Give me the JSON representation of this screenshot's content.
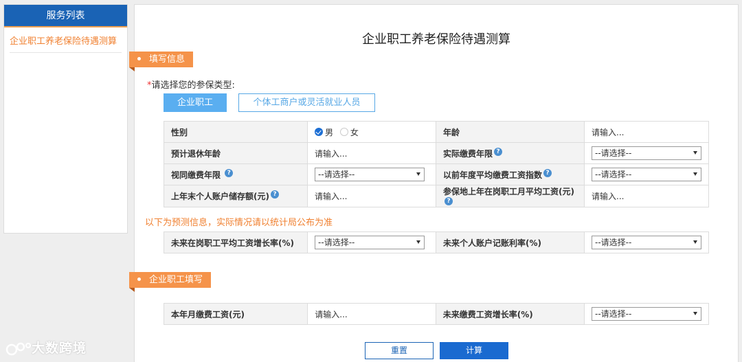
{
  "sidebar": {
    "header": "服务列表",
    "items": [
      {
        "label": "企业职工养老保险待遇测算"
      }
    ]
  },
  "main": {
    "title": "企业职工养老保险待遇测算",
    "section1": "填写信息",
    "type_label": "请选择您的参保类型:",
    "type_required_mark": "*",
    "type_options": [
      "企业职工",
      "个体工商户或灵活就业人员"
    ],
    "selected_type": "企业职工",
    "rows": {
      "gender_label": "性别",
      "gender_options": [
        "男",
        "女"
      ],
      "gender_selected": "男",
      "age_label": "年龄",
      "age_placeholder": "请输入...",
      "retire_age_label": "预计退休年龄",
      "retire_age_placeholder": "请输入...",
      "actual_years_label": "实际缴费年限",
      "actual_years_value": "--请选择--",
      "deemed_years_label": "视同缴费年限",
      "deemed_years_value": "--请选择--",
      "avg_index_label": "以前年度平均缴费工资指数",
      "avg_index_value": "--请选择--",
      "account_balance_label": "上年末个人账户储存额(元)",
      "account_balance_placeholder": "请输入...",
      "local_wage_label": "参保地上年在岗职工月平均工资(元)",
      "local_wage_placeholder": "请输入..."
    },
    "predict_note": "以下为预测信息，实际情况请以统计局公布为准",
    "predict_rows": {
      "wage_growth_label": "未来在岗职工平均工资增长率(%)",
      "wage_growth_value": "--请选择--",
      "account_rate_label": "未来个人账户记账利率(%)",
      "account_rate_value": "--请选择--"
    },
    "section2": "企业职工填写",
    "enterprise_rows": {
      "monthly_wage_label": "本年月缴费工资(元)",
      "monthly_wage_placeholder": "请输入...",
      "future_growth_label": "未来缴费工资增长率(%)",
      "future_growth_value": "--请选择--"
    },
    "buttons": {
      "reset": "重置",
      "calculate": "计算"
    }
  },
  "watermark": "大数跨境",
  "colors": {
    "primary": "#1a63b5",
    "accent": "#f5934a",
    "link": "#56a7e5"
  }
}
